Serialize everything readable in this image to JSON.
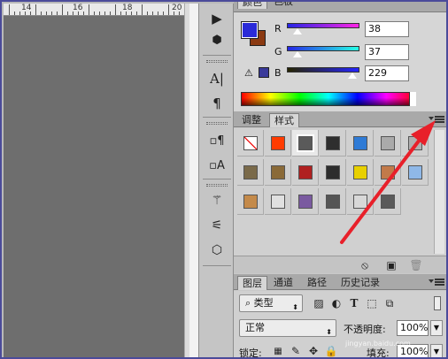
{
  "ruler": {
    "ticks": [
      "14",
      "16",
      "18",
      "20"
    ]
  },
  "tools": [
    {
      "icon": "play-icon",
      "glyph": "▶"
    },
    {
      "icon": "3d-cube-icon",
      "glyph": "⬢"
    },
    {
      "icon": "character-icon",
      "glyph": "A|"
    },
    {
      "icon": "paragraph-icon",
      "glyph": "¶"
    },
    {
      "icon": "paragraph-style-icon",
      "glyph": "¶"
    },
    {
      "icon": "character-style-icon",
      "glyph": "A"
    },
    {
      "icon": "brush-presets-icon",
      "glyph": "✎"
    },
    {
      "icon": "adjust-sliders-icon",
      "glyph": "☰"
    },
    {
      "icon": "3d-box-icon",
      "glyph": "⬛"
    }
  ],
  "color_panel": {
    "tabs": [
      "颜色",
      "色板"
    ],
    "fg_color": "#2a2ad8",
    "bg_color": "#8b3a12",
    "channels": [
      {
        "label": "R",
        "value": "38",
        "level": 0.15
      },
      {
        "label": "G",
        "value": "37",
        "level": 0.15
      },
      {
        "label": "B",
        "value": "229",
        "level": 0.9
      }
    ]
  },
  "style_panel": {
    "tabs": [
      "调整",
      "样式"
    ],
    "swatch_colors": [
      "#ffffff",
      "#ff3b00",
      "#5a5a5a",
      "#2e2e2e",
      "#2f7bd6",
      "#aaaaaa",
      "#b0b0b0",
      "#7a6a4a",
      "#8a6a38",
      "#b02020",
      "#2d2d2d",
      "#e8d000",
      "#c27a4a",
      "#8fb8e8",
      "#c48a4a",
      "#e0e0e0",
      "#7a5aa0",
      "#555555",
      "#d8d8d8",
      "#5a5a5a"
    ]
  },
  "layers_panel": {
    "tabs": [
      "图层",
      "通道",
      "路径",
      "历史记录"
    ],
    "kind_filter": "类型",
    "blend_mode": "正常",
    "opacity_label": "不透明度:",
    "opacity_value": "100%",
    "lock_label": "锁定:",
    "fill_label": "填充:",
    "fill_value": "100%"
  },
  "watermark": "jingyan.baidu.com"
}
